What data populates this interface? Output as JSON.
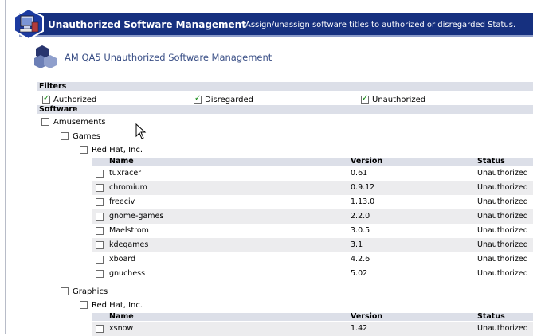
{
  "header": {
    "title": "Unauthorized Software Management",
    "subtitle": "Assign/unassign software titles to authorized or disregarded Status."
  },
  "page_title": "AM QA5 Unauthorized Software Management",
  "filters": {
    "heading": "Filters",
    "items": [
      {
        "label": "Authorized",
        "checked": true
      },
      {
        "label": "Disregarded",
        "checked": true
      },
      {
        "label": "Unauthorized",
        "checked": true
      }
    ]
  },
  "software": {
    "heading": "Software",
    "category1": "Amusements",
    "subcat1": "Games",
    "vendor1": "Red Hat, Inc.",
    "subcat2": "Graphics",
    "vendor2": "Red Hat, Inc.",
    "columns": {
      "name": "Name",
      "version": "Version",
      "status": "Status"
    },
    "games_rows": [
      {
        "name": "tuxracer",
        "version": "0.61",
        "status": "Unauthorized"
      },
      {
        "name": "chromium",
        "version": "0.9.12",
        "status": "Unauthorized"
      },
      {
        "name": "freeciv",
        "version": "1.13.0",
        "status": "Unauthorized"
      },
      {
        "name": "gnome-games",
        "version": "2.2.0",
        "status": "Unauthorized"
      },
      {
        "name": "Maelstrom",
        "version": "3.0.5",
        "status": "Unauthorized"
      },
      {
        "name": "kdegames",
        "version": "3.1",
        "status": "Unauthorized"
      },
      {
        "name": "xboard",
        "version": "4.2.6",
        "status": "Unauthorized"
      },
      {
        "name": "gnuchess",
        "version": "5.02",
        "status": "Unauthorized"
      }
    ],
    "graphics_rows": [
      {
        "name": "xsnow",
        "version": "1.42",
        "status": "Unauthorized"
      }
    ]
  },
  "colors": {
    "header_band": "#16307f",
    "section_bar": "#dcdfe8",
    "row_alt": "#ececee"
  }
}
